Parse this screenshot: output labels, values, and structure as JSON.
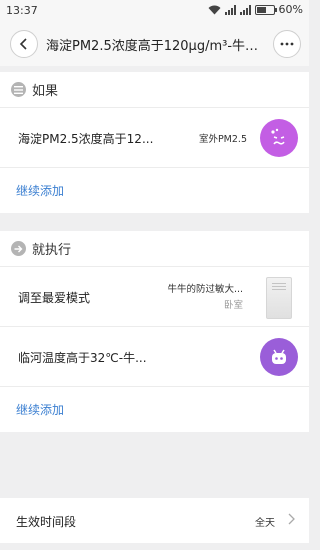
{
  "status": {
    "time": "13:37",
    "battery": "60%",
    "battery_level": 0.6
  },
  "header": {
    "back_icon": "chevron-left-icon",
    "title": "海淀PM2.5浓度高于120μg/m³-牛牛的防过敏大...",
    "more_icon": "more-dots-icon"
  },
  "condition": {
    "title": "如果",
    "icon": "list-icon",
    "items": [
      {
        "label": "海淀PM2.5浓度高于12...",
        "value": "室外PM2.5",
        "icon": "pm25-face-icon",
        "icon_color": "#c35ee4"
      }
    ],
    "add_label": "继续添加"
  },
  "action": {
    "title": "就执行",
    "icon": "arrow-right-icon",
    "items": [
      {
        "label": "调至最爱模式",
        "device_name": "牛牛的防过敏大...",
        "device_room": "卧室",
        "icon": "air-purifier-icon"
      },
      {
        "label": "临河温度高于32℃-牛...",
        "icon": "robot-icon",
        "icon_color": "#9a5ed9"
      }
    ],
    "add_label": "继续添加"
  },
  "effective_time": {
    "label": "生效时间段",
    "value": "全天",
    "icon": "chevron-right-icon"
  },
  "colors": {
    "accent_link": "#3b7fd1",
    "pm25_icon": "#c35ee4",
    "scene_icon": "#9a5ed9"
  }
}
